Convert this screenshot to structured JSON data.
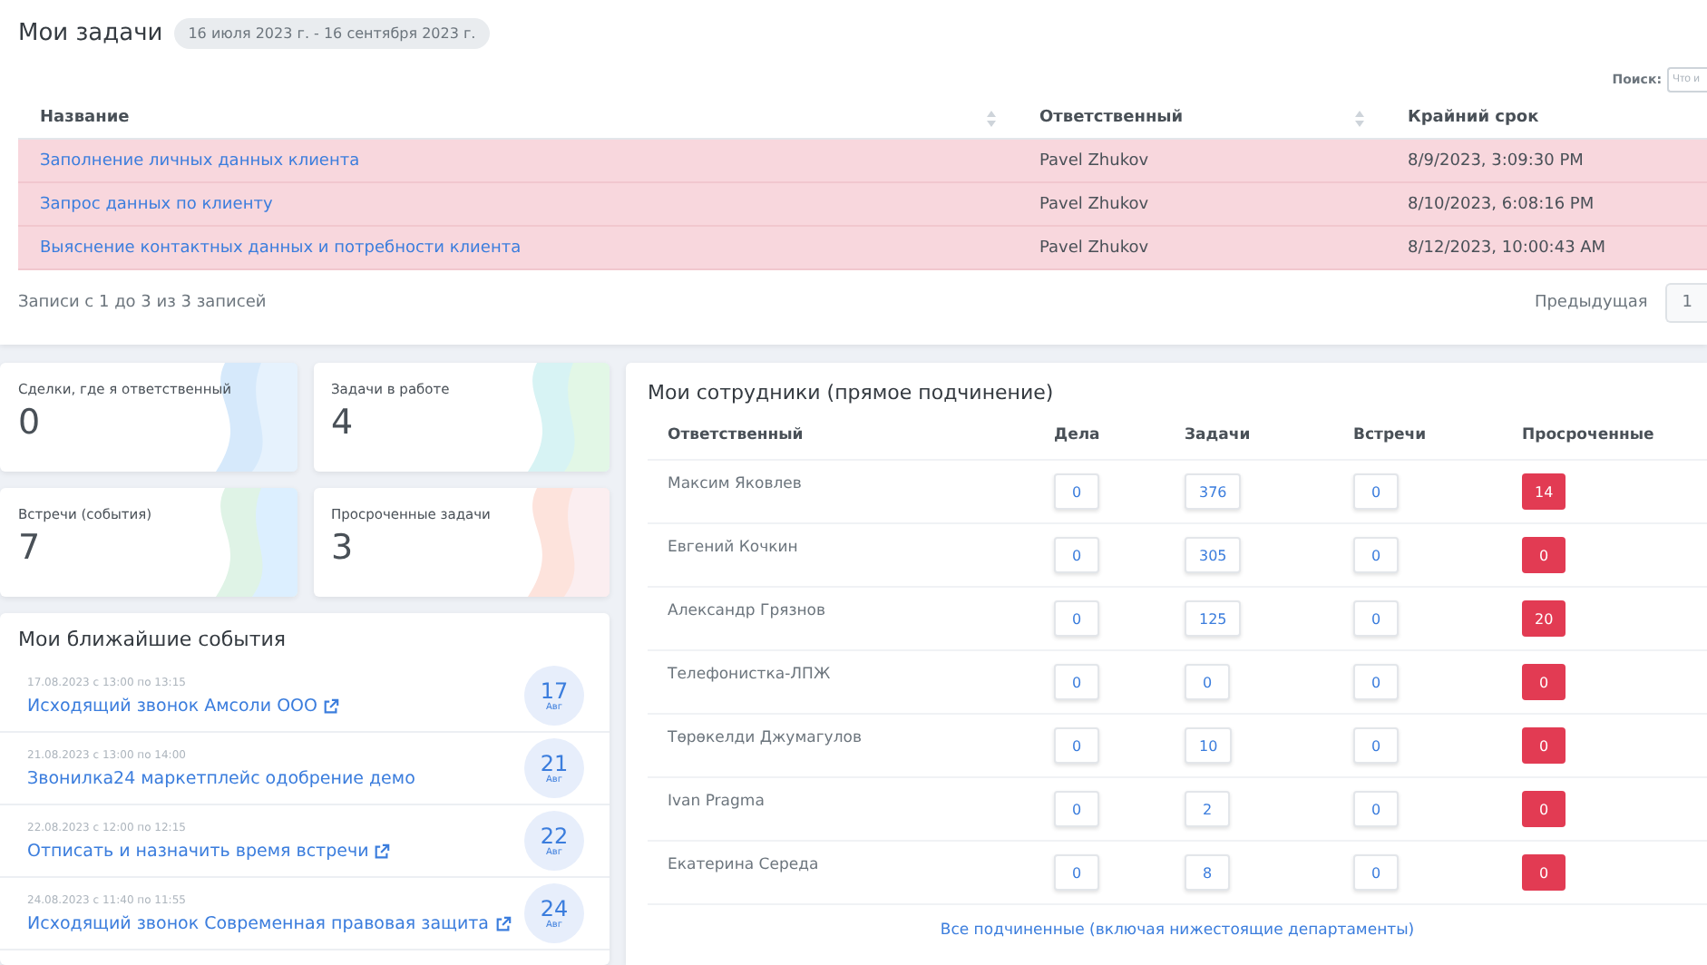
{
  "tasks": {
    "title": "Мои задачи",
    "period": "16 июля 2023 г. - 16 сентября 2023 г.",
    "search": {
      "label": "Поиск:",
      "placeholder": "Что и"
    },
    "columns": [
      {
        "label": "Название",
        "sortable": true
      },
      {
        "label": "Ответственный",
        "sortable": true
      },
      {
        "label": "Крайний срок",
        "sortable": false
      }
    ],
    "rows": [
      {
        "name": "Заполнение личных данных клиента",
        "owner": "Pavel Zhukov",
        "deadline": "8/9/2023, 3:09:30 PM",
        "overdue": true
      },
      {
        "name": "Запрос данных по клиенту",
        "owner": "Pavel Zhukov",
        "deadline": "8/10/2023, 6:08:16 PM",
        "overdue": true
      },
      {
        "name": "Выяснение контактных данных и потребности клиента",
        "owner": "Pavel Zhukov",
        "deadline": "8/12/2023, 10:00:43 AM",
        "overdue": true
      }
    ],
    "info": "Записи с 1 до 3 из 3 записей",
    "pagination": {
      "previous": "Предыдущая",
      "page": "1"
    }
  },
  "stats": [
    {
      "label": "Сделки, где я ответственный",
      "value": "0"
    },
    {
      "label": "Задачи в работе",
      "value": "4"
    },
    {
      "label": "Встречи (события)",
      "value": "7"
    },
    {
      "label": "Просроченные задачи",
      "value": "3"
    }
  ],
  "events": {
    "title": "Мои ближайшие события",
    "items": [
      {
        "time": "17.08.2023 с 13:00 по 13:15",
        "title": "Исходящий звонок Амсоли ООО",
        "external": true,
        "day": "17",
        "month": "Авг"
      },
      {
        "time": "21.08.2023 с 13:00 по 14:00",
        "title": "Звонилка24 маркетплейс одобрение демо",
        "external": false,
        "day": "21",
        "month": "Авг"
      },
      {
        "time": "22.08.2023 с 12:00 по 12:15",
        "title": "Отписать и назначить время встречи",
        "external": true,
        "day": "22",
        "month": "Авг"
      },
      {
        "time": "24.08.2023 с 11:40 по 11:55",
        "title": "Исходящий звонок Современная правовая защита",
        "external": true,
        "day": "24",
        "month": "Авг"
      }
    ]
  },
  "staff": {
    "title": "Мои сотрудники (прямое подчинение)",
    "columns": [
      "Ответственный",
      "Дела",
      "Задачи",
      "Встречи",
      "Просроченные"
    ],
    "rows": [
      {
        "name": "Максим Яковлев",
        "deals": "0",
        "tasks": "376",
        "meetings": "0",
        "overdue": "14"
      },
      {
        "name": "Евгений Кочкин",
        "deals": "0",
        "tasks": "305",
        "meetings": "0",
        "overdue": "0"
      },
      {
        "name": "Александр Грязнов",
        "deals": "0",
        "tasks": "125",
        "meetings": "0",
        "overdue": "20"
      },
      {
        "name": "Телефонистка-ЛПЖ",
        "deals": "0",
        "tasks": "0",
        "meetings": "0",
        "overdue": "0"
      },
      {
        "name": "Төрөкелди Джумагулов",
        "deals": "0",
        "tasks": "10",
        "meetings": "0",
        "overdue": "0"
      },
      {
        "name": "Ivan Pragma",
        "deals": "0",
        "tasks": "2",
        "meetings": "0",
        "overdue": "0"
      },
      {
        "name": "Екатерина Середа",
        "deals": "0",
        "tasks": "8",
        "meetings": "0",
        "overdue": "0"
      }
    ],
    "all_link": "Все подчиненные (включая нижестоящие департаменты)"
  }
}
